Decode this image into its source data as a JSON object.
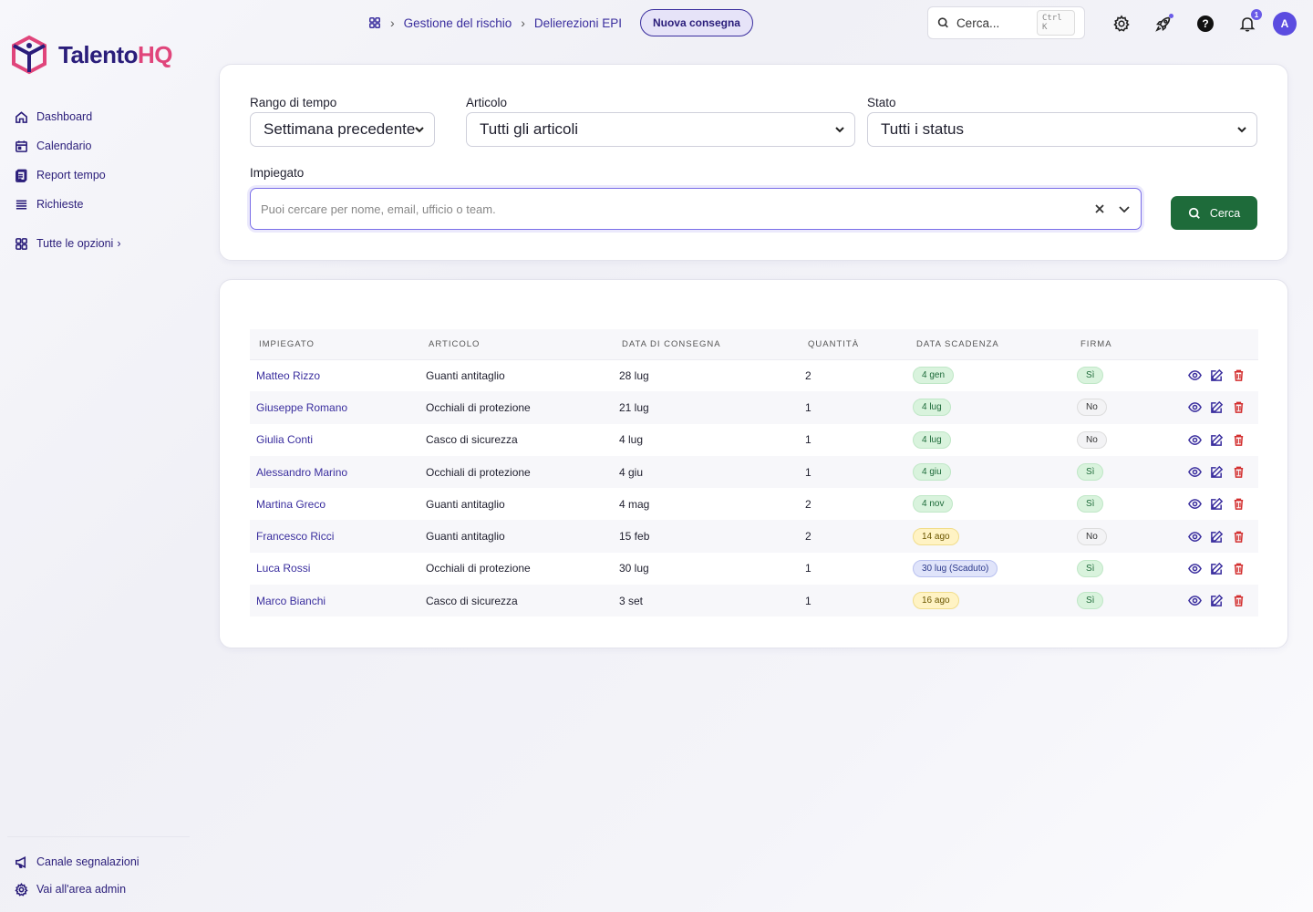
{
  "brand": {
    "name_main": "Talento",
    "name_accent": "HQ",
    "primary": "#2a1d7a",
    "accent": "#e0457b"
  },
  "sidebar": {
    "items": [
      {
        "label": "Dashboard",
        "icon": "home-icon"
      },
      {
        "label": "Calendario",
        "icon": "calendar-icon"
      },
      {
        "label": "Report tempo",
        "icon": "report-icon"
      },
      {
        "label": "Richieste",
        "icon": "list-icon"
      }
    ],
    "all_options": "Tutte le opzioni",
    "bottom": [
      {
        "label": "Canale segnalazioni",
        "icon": "megaphone-icon"
      },
      {
        "label": "Vai all'area admin",
        "icon": "gear-icon"
      }
    ]
  },
  "header": {
    "breadcrumb": [
      "Gestione del rischio",
      "Delierezioni EPI"
    ],
    "new_button": "Nuova consegna",
    "search_placeholder": "Cerca...",
    "search_shortcut": "Ctrl K",
    "notification_count": "1",
    "avatar_initial": "A"
  },
  "filters": {
    "time_range": {
      "label": "Rango di tempo",
      "value": "Settimana precedente"
    },
    "article": {
      "label": "Articolo",
      "value": "Tutti gli articoli"
    },
    "status": {
      "label": "Stato",
      "value": "Tutti i status"
    },
    "employee": {
      "label": "Impiegato",
      "placeholder": "Puoi cercare per nome, email, ufficio o team."
    },
    "search_button": "Cerca"
  },
  "table": {
    "headers": [
      "Impiegato",
      "Articolo",
      "Data di consegna",
      "Quantità",
      "Data scadenza",
      "Firma"
    ],
    "rows": [
      {
        "employee": "Matteo Rizzo",
        "article": "Guanti antitaglio",
        "delivery": "28 lug",
        "qty": "2",
        "expiry": "4 gen",
        "expiry_status": "green",
        "signature": "Sì"
      },
      {
        "employee": "Giuseppe Romano",
        "article": "Occhiali di protezione",
        "delivery": "21 lug",
        "qty": "1",
        "expiry": "4 lug",
        "expiry_status": "green",
        "signature": "No"
      },
      {
        "employee": "Giulia Conti",
        "article": "Casco di sicurezza",
        "delivery": "4 lug",
        "qty": "1",
        "expiry": "4 lug",
        "expiry_status": "green",
        "signature": "No"
      },
      {
        "employee": "Alessandro Marino",
        "article": "Occhiali di protezione",
        "delivery": "4 giu",
        "qty": "1",
        "expiry": "4 giu",
        "expiry_status": "green",
        "signature": "Sì"
      },
      {
        "employee": "Martina Greco",
        "article": "Guanti antitaglio",
        "delivery": "4 mag",
        "qty": "2",
        "expiry": "4 nov",
        "expiry_status": "green",
        "signature": "Sì"
      },
      {
        "employee": "Francesco Ricci",
        "article": "Guanti antitaglio",
        "delivery": "15 feb",
        "qty": "2",
        "expiry": "14 ago",
        "expiry_status": "yellow",
        "signature": "No"
      },
      {
        "employee": "Luca Rossi",
        "article": "Occhiali di protezione",
        "delivery": "30 lug",
        "qty": "1",
        "expiry": "30 lug (Scaduto)",
        "expiry_status": "blue",
        "signature": "Sì"
      },
      {
        "employee": "Marco Bianchi",
        "article": "Casco di sicurezza",
        "delivery": "3 set",
        "qty": "1",
        "expiry": "16 ago",
        "expiry_status": "yellow",
        "signature": "Sì"
      }
    ]
  },
  "colors": {
    "search_button": "#1e6b3a",
    "link": "#3a2e9e",
    "delete": "#d32f2f"
  }
}
